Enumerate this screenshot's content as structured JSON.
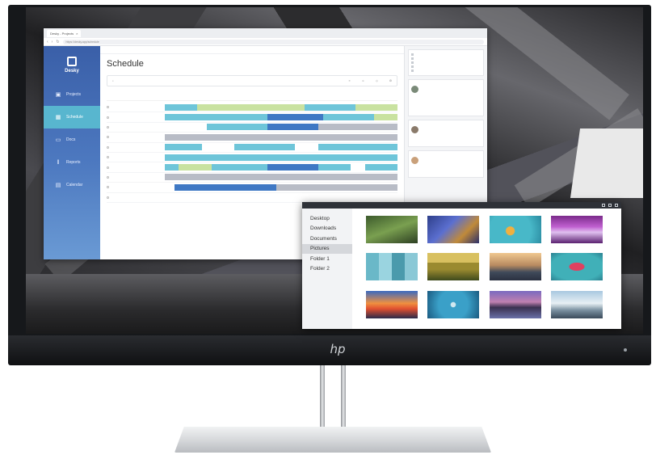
{
  "colors": {
    "sidebar": "#4d79c0",
    "sidebar_active": "#58b6cf",
    "bar_cyan": "#6ec5d9",
    "bar_blue": "#3f78c4",
    "bar_lime": "#c9e2a0",
    "bar_gray": "#b8bcc6"
  },
  "browser": {
    "tab_label": "Desky - Projects",
    "address": "https://desky.app/schedule"
  },
  "app": {
    "brand": "Desky",
    "nav": [
      {
        "label": "Projects",
        "icon": "briefcase-icon"
      },
      {
        "label": "Schedule",
        "icon": "calendar-icon"
      },
      {
        "label": "Docs",
        "icon": "document-icon"
      },
      {
        "label": "Reports",
        "icon": "chart-icon"
      },
      {
        "label": "Calendar",
        "icon": "calendar-grid-icon"
      }
    ],
    "title": "Schedule"
  },
  "explorer": {
    "folders": [
      "Desktop",
      "Downloads",
      "Documents",
      "Pictures",
      "Folder 1",
      "Folder 2"
    ],
    "active_folder": "Pictures"
  }
}
